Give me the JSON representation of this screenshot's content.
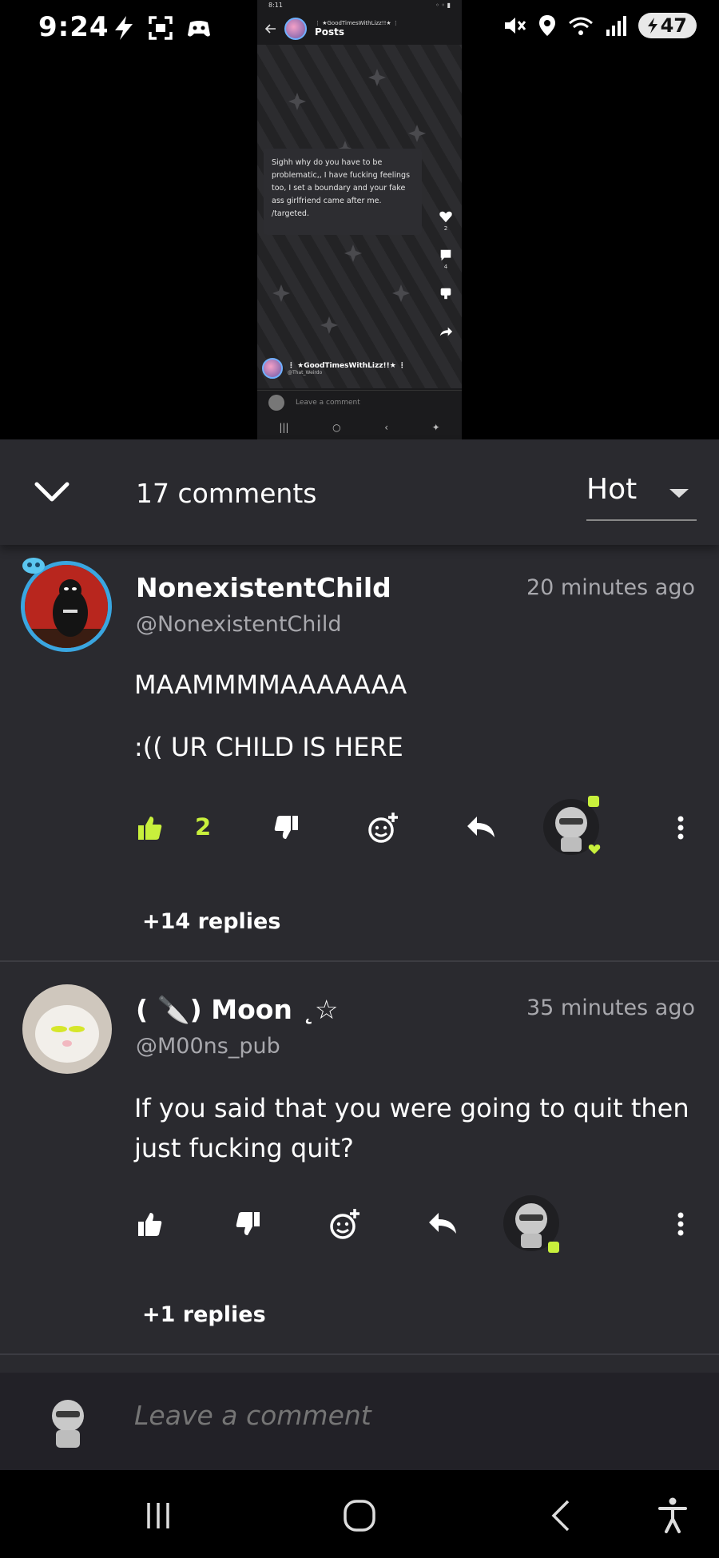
{
  "status_bar": {
    "time": "9:24",
    "battery": "47",
    "left_icons": [
      "flash-icon",
      "screenshot-icon",
      "gamepad-icon"
    ],
    "right_icons": [
      "mute-icon",
      "location-icon",
      "wifi-icon",
      "signal-icon",
      "battery-icon"
    ]
  },
  "preview": {
    "status_time": "8:11",
    "header_subtitle": "⋮ ★GoodTimesWithLizz!!★ ⋮",
    "header_title": "Posts",
    "post_text": "Sighh why do you have to be problematic,, I have fucking feelings too, I set a boundary and your fake ass girlfriend came after me. /targeted.",
    "like_count": "2",
    "comment_count": "4",
    "author_name": "⋮ ★GoodTimesWithLizz!!★ ⋮",
    "author_handle": "@That_Weirdo",
    "comment_placeholder": "Leave a comment"
  },
  "comments_header": {
    "count_label": "17 comments",
    "sort_selected": "Hot"
  },
  "comments": [
    {
      "name": "NonexistentChild",
      "handle": "@NonexistentChild",
      "time": "20 minutes ago",
      "line1": "MAAMMMMAAAAAAA",
      "line2": ":(( UR CHILD IS HERE",
      "likes": "2",
      "replies": "+14 replies"
    },
    {
      "name": "( 🔪) Moon ˛☆",
      "handle": "@M00ns_pub",
      "time": "35 minutes ago",
      "text": "If you said that you were going to quit then just fucking quit?",
      "replies": "+1 replies"
    }
  ],
  "leave_comment": {
    "placeholder": "Leave a comment"
  },
  "colors": {
    "sheet_bg": "#2a2a2f",
    "accent_green": "#c8f03c",
    "muted_text": "#a8a8ad",
    "leave_bg": "#222127"
  }
}
